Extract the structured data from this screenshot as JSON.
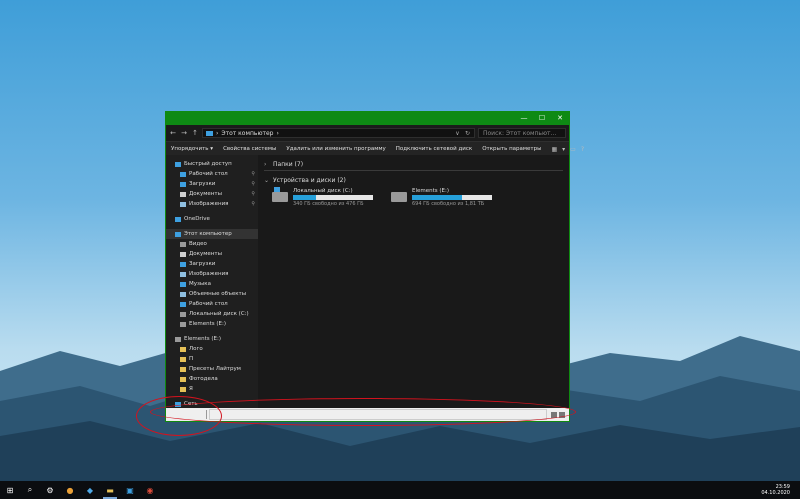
{
  "window": {
    "caption_buttons": [
      "—",
      "☐",
      "✕"
    ],
    "address": {
      "back": "←",
      "forward": "→",
      "up": "↑",
      "path": "Этот компьютер",
      "path_chevron": "›",
      "dropdown": "∨",
      "refresh": "↻",
      "search_placeholder": "Поиск: Этот компьют..."
    },
    "ribbon": {
      "items": [
        "Упорядочить ▾",
        "Свойства системы",
        "Удалить или изменить программу",
        "Подключить сетевой диск",
        "Открыть параметры"
      ],
      "right_icons": [
        "view-icon",
        "dropdown-icon",
        "preview-icon",
        "help-icon"
      ]
    },
    "nav_pane": [
      {
        "label": "Быстрый доступ",
        "icon": "star-icon",
        "color": "#3ea0e0"
      },
      {
        "label": "Рабочий стол",
        "icon": "desktop-icon",
        "color": "#3ea0e0",
        "pinned": true
      },
      {
        "label": "Загрузки",
        "icon": "download-icon",
        "color": "#3ea0e0",
        "pinned": true
      },
      {
        "label": "Документы",
        "icon": "document-icon",
        "color": "#cfcfcf",
        "pinned": true
      },
      {
        "label": "Изображения",
        "icon": "image-icon",
        "color": "#8fbfe0",
        "pinned": true
      },
      {
        "label": "OneDrive",
        "icon": "cloud-icon",
        "color": "#3ea0e0"
      },
      {
        "label": "Этот компьютер",
        "icon": "computer-icon",
        "color": "#3ea0e0",
        "selected": true
      },
      {
        "label": "Видео",
        "icon": "video-icon",
        "color": "#9a9a9a"
      },
      {
        "label": "Документы",
        "icon": "document-icon",
        "color": "#cfcfcf"
      },
      {
        "label": "Загрузки",
        "icon": "download-icon",
        "color": "#3ea0e0"
      },
      {
        "label": "Изображения",
        "icon": "image-icon",
        "color": "#8fbfe0"
      },
      {
        "label": "Музыка",
        "icon": "music-icon",
        "color": "#3ea0e0"
      },
      {
        "label": "Объемные объекты",
        "icon": "cube-icon",
        "color": "#8fbfe0"
      },
      {
        "label": "Рабочий стол",
        "icon": "desktop-icon",
        "color": "#3ea0e0"
      },
      {
        "label": "Локальный диск (C:)",
        "icon": "drive-icon",
        "color": "#9a9a9a"
      },
      {
        "label": "Elements (E:)",
        "icon": "drive-icon",
        "color": "#9a9a9a"
      },
      {
        "label": "Elements (E:)",
        "icon": "drive-icon",
        "color": "#9a9a9a"
      },
      {
        "label": "Лого",
        "icon": "folder-icon",
        "color": "#e6c157"
      },
      {
        "label": "П",
        "icon": "folder-icon",
        "color": "#e6c157"
      },
      {
        "label": "Пресеты Лайтрум",
        "icon": "folder-icon",
        "color": "#e6c157"
      },
      {
        "label": "Фотодела",
        "icon": "folder-icon",
        "color": "#e6c157"
      },
      {
        "label": "Я",
        "icon": "folder-icon",
        "color": "#e6c157"
      },
      {
        "label": "Сеть",
        "icon": "network-icon",
        "color": "#3ea0e0"
      }
    ],
    "content": {
      "folders_header": "Папки (7)",
      "devices_header": "Устройства и диски (2)",
      "drives": [
        {
          "name": "Локальный диск (C:)",
          "free": "340 ГБ свободно из 476 ГБ",
          "used_fraction": 0.29
        },
        {
          "name": "Elements (E:)",
          "free": "694 ГБ свободно из 1,81 ТБ",
          "used_fraction": 0.63
        }
      ]
    }
  },
  "taskbar": {
    "buttons": [
      "start-icon",
      "search-icon",
      "settings-icon",
      "yandex-browser-icon",
      "paint-icon",
      "file-explorer-icon",
      "video-app-icon",
      "chrome-icon"
    ],
    "time": "23:59",
    "date": "04.10.2020"
  },
  "colors": {
    "titlebar": "#0e8a14",
    "accent": "#26a0da",
    "annotation": "#d3131e"
  }
}
